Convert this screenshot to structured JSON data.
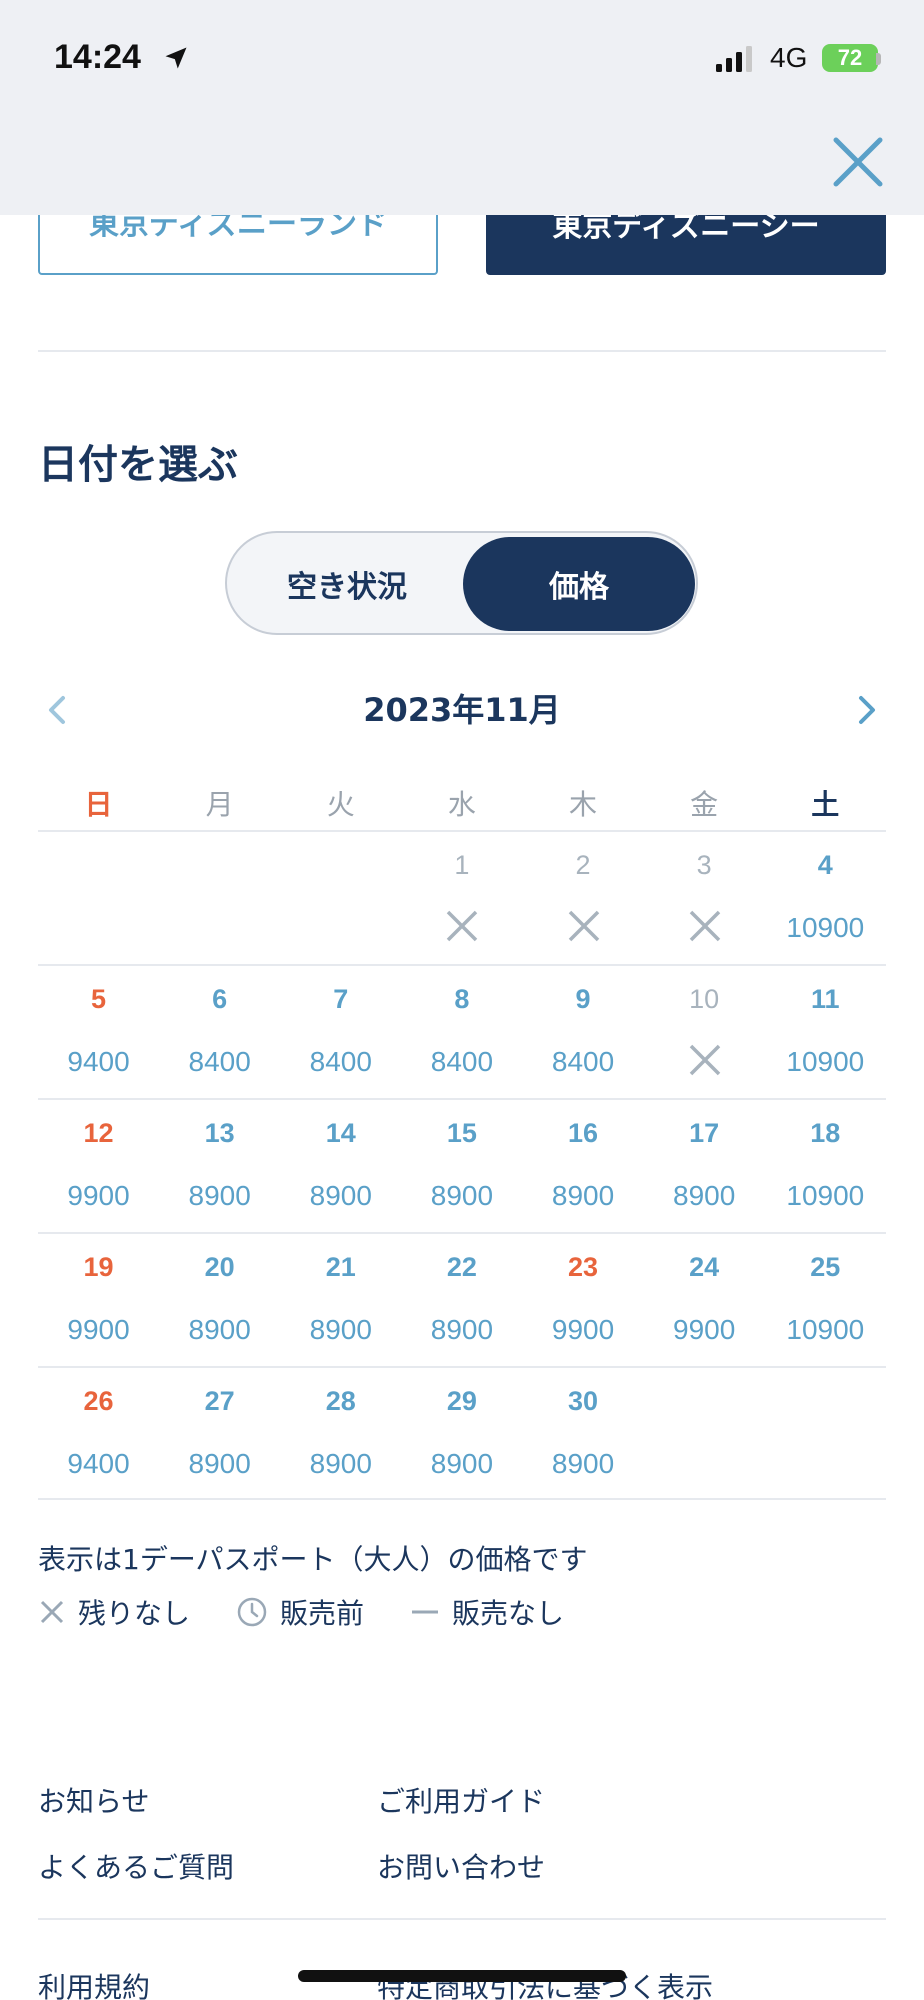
{
  "status_bar": {
    "time": "14:24",
    "network": "4G",
    "battery": "72"
  },
  "park_tabs": {
    "land": "東京ディズニーランド",
    "sea": "東京ディズニーシー"
  },
  "section_title": "日付を選ぶ",
  "toggle": {
    "left": "空き状況",
    "right": "価格",
    "selected": "価格"
  },
  "calendar": {
    "month_label": "2023年11月",
    "weekdays": [
      "日",
      "月",
      "火",
      "水",
      "木",
      "金",
      "土"
    ],
    "weeks": [
      [
        null,
        null,
        null,
        {
          "day": "1",
          "price": "",
          "status": "sold-out"
        },
        {
          "day": "2",
          "price": "",
          "status": "sold-out"
        },
        {
          "day": "3",
          "price": "",
          "status": "sold-out"
        },
        {
          "day": "4",
          "price": "10900"
        }
      ],
      [
        {
          "day": "5",
          "price": "9400"
        },
        {
          "day": "6",
          "price": "8400"
        },
        {
          "day": "7",
          "price": "8400"
        },
        {
          "day": "8",
          "price": "8400"
        },
        {
          "day": "9",
          "price": "8400"
        },
        {
          "day": "10",
          "price": "",
          "status": "sold-out"
        },
        {
          "day": "11",
          "price": "10900"
        }
      ],
      [
        {
          "day": "12",
          "price": "9900"
        },
        {
          "day": "13",
          "price": "8900"
        },
        {
          "day": "14",
          "price": "8900"
        },
        {
          "day": "15",
          "price": "8900"
        },
        {
          "day": "16",
          "price": "8900"
        },
        {
          "day": "17",
          "price": "8900"
        },
        {
          "day": "18",
          "price": "10900"
        }
      ],
      [
        {
          "day": "19",
          "price": "9900"
        },
        {
          "day": "20",
          "price": "8900"
        },
        {
          "day": "21",
          "price": "8900"
        },
        {
          "day": "22",
          "price": "8900"
        },
        {
          "day": "23",
          "price": "9900",
          "holiday": true
        },
        {
          "day": "24",
          "price": "9900"
        },
        {
          "day": "25",
          "price": "10900"
        }
      ],
      [
        {
          "day": "26",
          "price": "9400"
        },
        {
          "day": "27",
          "price": "8900"
        },
        {
          "day": "28",
          "price": "8900"
        },
        {
          "day": "29",
          "price": "8900"
        },
        {
          "day": "30",
          "price": "8900"
        },
        null,
        null
      ]
    ]
  },
  "note": "表示は1デーパスポート（大人）の価格です",
  "legend": {
    "sold_out": "残りなし",
    "before_sale": "販売前",
    "not_sold": "販売なし"
  },
  "footer": {
    "news": "お知らせ",
    "guide": "ご利用ガイド",
    "faq": "よくあるご質問",
    "contact": "お問い合わせ",
    "terms": "利用規約",
    "commerce_law": "特定商取引法に基づく表示"
  },
  "colors": {
    "navy": "#1b365d",
    "blue": "#5aa0c8",
    "sunday": "#e8643c",
    "gray": "#a8b3bd"
  }
}
